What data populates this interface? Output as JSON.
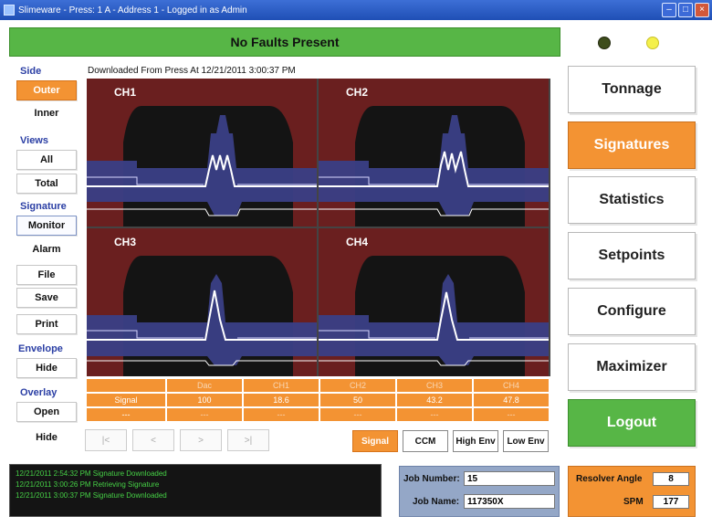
{
  "window": {
    "title": "Slimeware - Press: 1 A - Address 1 - Logged in as Admin"
  },
  "status": {
    "message": "No Faults Present"
  },
  "sidebar": {
    "side_label": "Side",
    "outer": "Outer",
    "inner": "Inner",
    "views_label": "Views",
    "all": "All",
    "total": "Total",
    "signature_label": "Signature",
    "monitor": "Monitor",
    "alarm": "Alarm",
    "file": "File",
    "save": "Save",
    "print": "Print",
    "envelope_label": "Envelope",
    "envelope_hide": "Hide",
    "overlay_label": "Overlay",
    "open": "Open",
    "overlay_hide": "Hide"
  },
  "download_text": "Downloaded From Press At 12/21/2011 3:00:37 PM",
  "channels": [
    "CH1",
    "CH2",
    "CH3",
    "CH4"
  ],
  "table": {
    "headers": [
      "",
      "Dac",
      "CH1",
      "CH2",
      "CH3",
      "CH4"
    ],
    "row_label": "Signal",
    "values": [
      "100",
      "18.6",
      "50",
      "43.2",
      "47.8"
    ],
    "dashes": [
      "---",
      "---",
      "---",
      "---",
      "---",
      "---"
    ]
  },
  "nav": {
    "first": "|<",
    "prev": "<",
    "next": ">",
    "last": ">|"
  },
  "modes": {
    "signal": "Signal",
    "ccm": "CCM",
    "high_env": "High Env",
    "low_env": "Low Env"
  },
  "menu": {
    "tonnage": "Tonnage",
    "signatures": "Signatures",
    "statistics": "Statistics",
    "setpoints": "Setpoints",
    "configure": "Configure",
    "maximizer": "Maximizer",
    "logout": "Logout"
  },
  "log": [
    "12/21/2011 2:54:32 PM  Signature Downloaded",
    "12/21/2011 3:00:26 PM  Retrieving Signature",
    "12/21/2011 3:00:37 PM  Signature Downloaded"
  ],
  "job": {
    "number_label": "Job Number:",
    "number": "15",
    "name_label": "Job Name:",
    "name": "117350X"
  },
  "resolver": {
    "angle_label": "Resolver Angle",
    "angle": "8",
    "spm_label": "SPM",
    "spm": "177"
  },
  "colors": {
    "accent_orange": "#f39333",
    "status_green": "#57b646",
    "plot_dark_red": "#6a1f1f",
    "plot_blue": "#3a3f86"
  }
}
